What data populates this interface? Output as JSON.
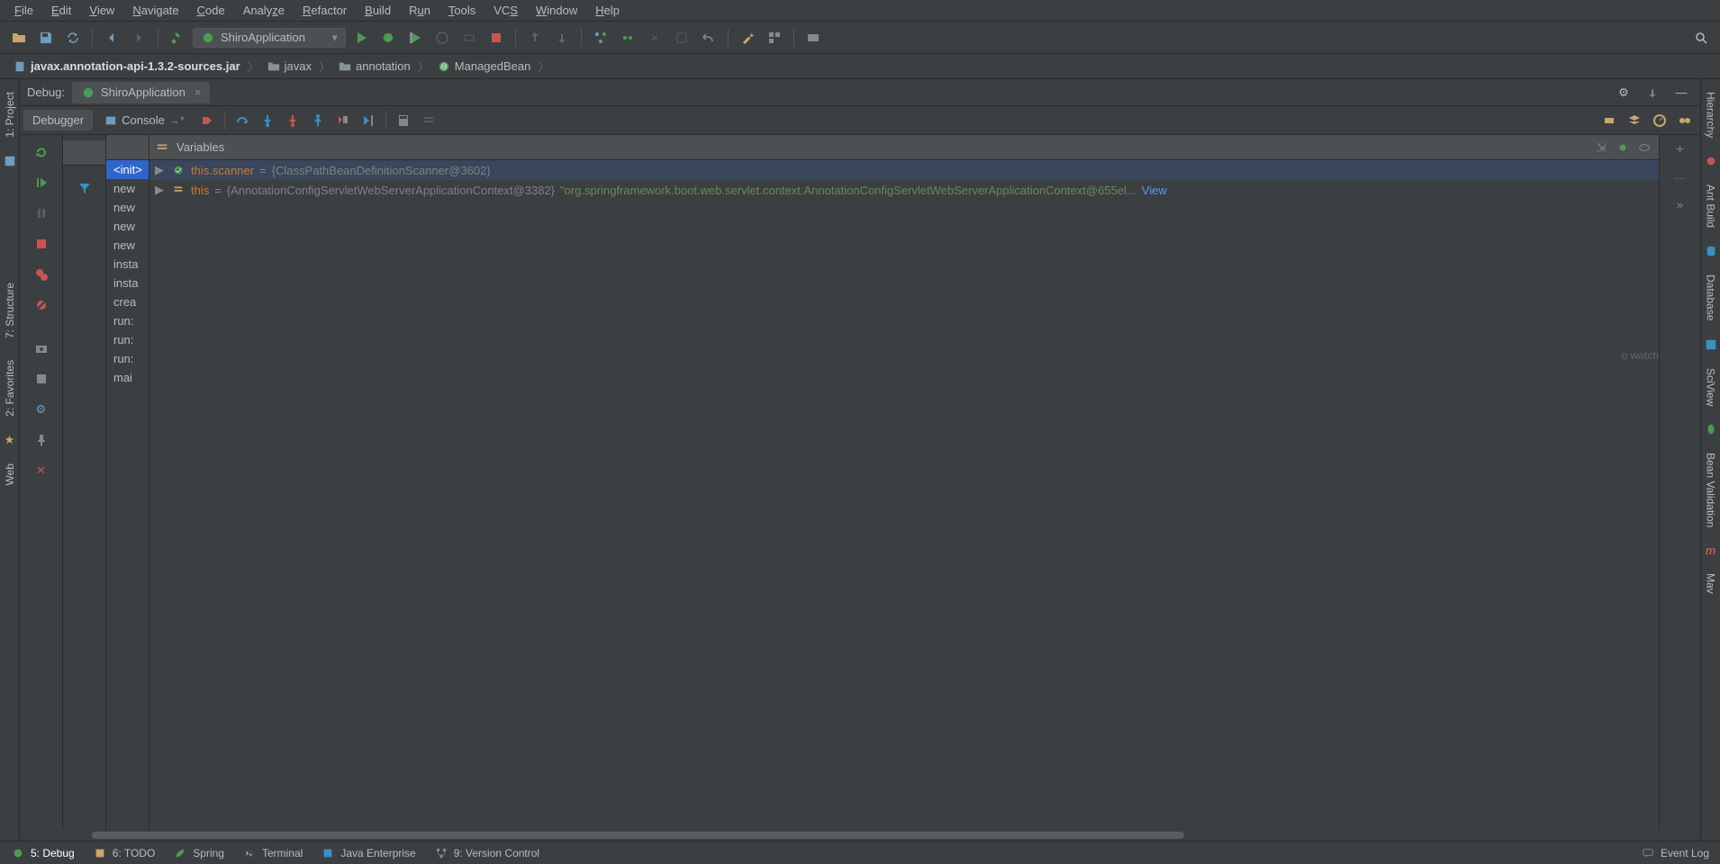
{
  "menu": [
    "File",
    "Edit",
    "View",
    "Navigate",
    "Code",
    "Analyze",
    "Refactor",
    "Build",
    "Run",
    "Tools",
    "VCS",
    "Window",
    "Help"
  ],
  "runConfig": {
    "name": "ShiroApplication"
  },
  "breadcrumb": {
    "jar": "javax.annotation-api-1.3.2-sources.jar",
    "pkg1": "javax",
    "pkg2": "annotation",
    "class": "ManagedBean"
  },
  "debug": {
    "label": "Debug:",
    "tab": "ShiroApplication",
    "subtabs": {
      "debugger": "Debugger",
      "console": "Console"
    },
    "varsHeader": "Variables",
    "frames": [
      "<init>",
      "new",
      "new",
      "new",
      "new",
      "insta",
      "insta",
      "crea",
      "run:",
      "run:",
      "run:",
      "mai"
    ],
    "vars": [
      {
        "name": "this",
        "obj": "{AnnotationConfigServletWebServerApplicationContext@3382}",
        "str": "\"org.springframework.boot.web.servlet.context.AnnotationConfigServletWebServerApplicationContext@655el...",
        "view": "View"
      },
      {
        "name": "this.scanner",
        "obj": "{ClassPathBeanDefinitionScanner@3602}",
        "str": "",
        "view": ""
      }
    ],
    "watchHint": "o watch"
  },
  "status": {
    "debug": "5: Debug",
    "todo": "6: TODO",
    "spring": "Spring",
    "terminal": "Terminal",
    "je": "Java Enterprise",
    "vc": "9: Version Control",
    "event": "Event Log"
  },
  "leftTabs": {
    "project": "1: Project",
    "structure": "7: Structure",
    "favorites": "2: Favorites",
    "web": "Web"
  },
  "rightTabs": {
    "hierarchy": "Hierarchy",
    "ant": "Ant Build",
    "database": "Database",
    "sci": "SciView",
    "bean": "Bean Validation",
    "mav": "Mav"
  }
}
